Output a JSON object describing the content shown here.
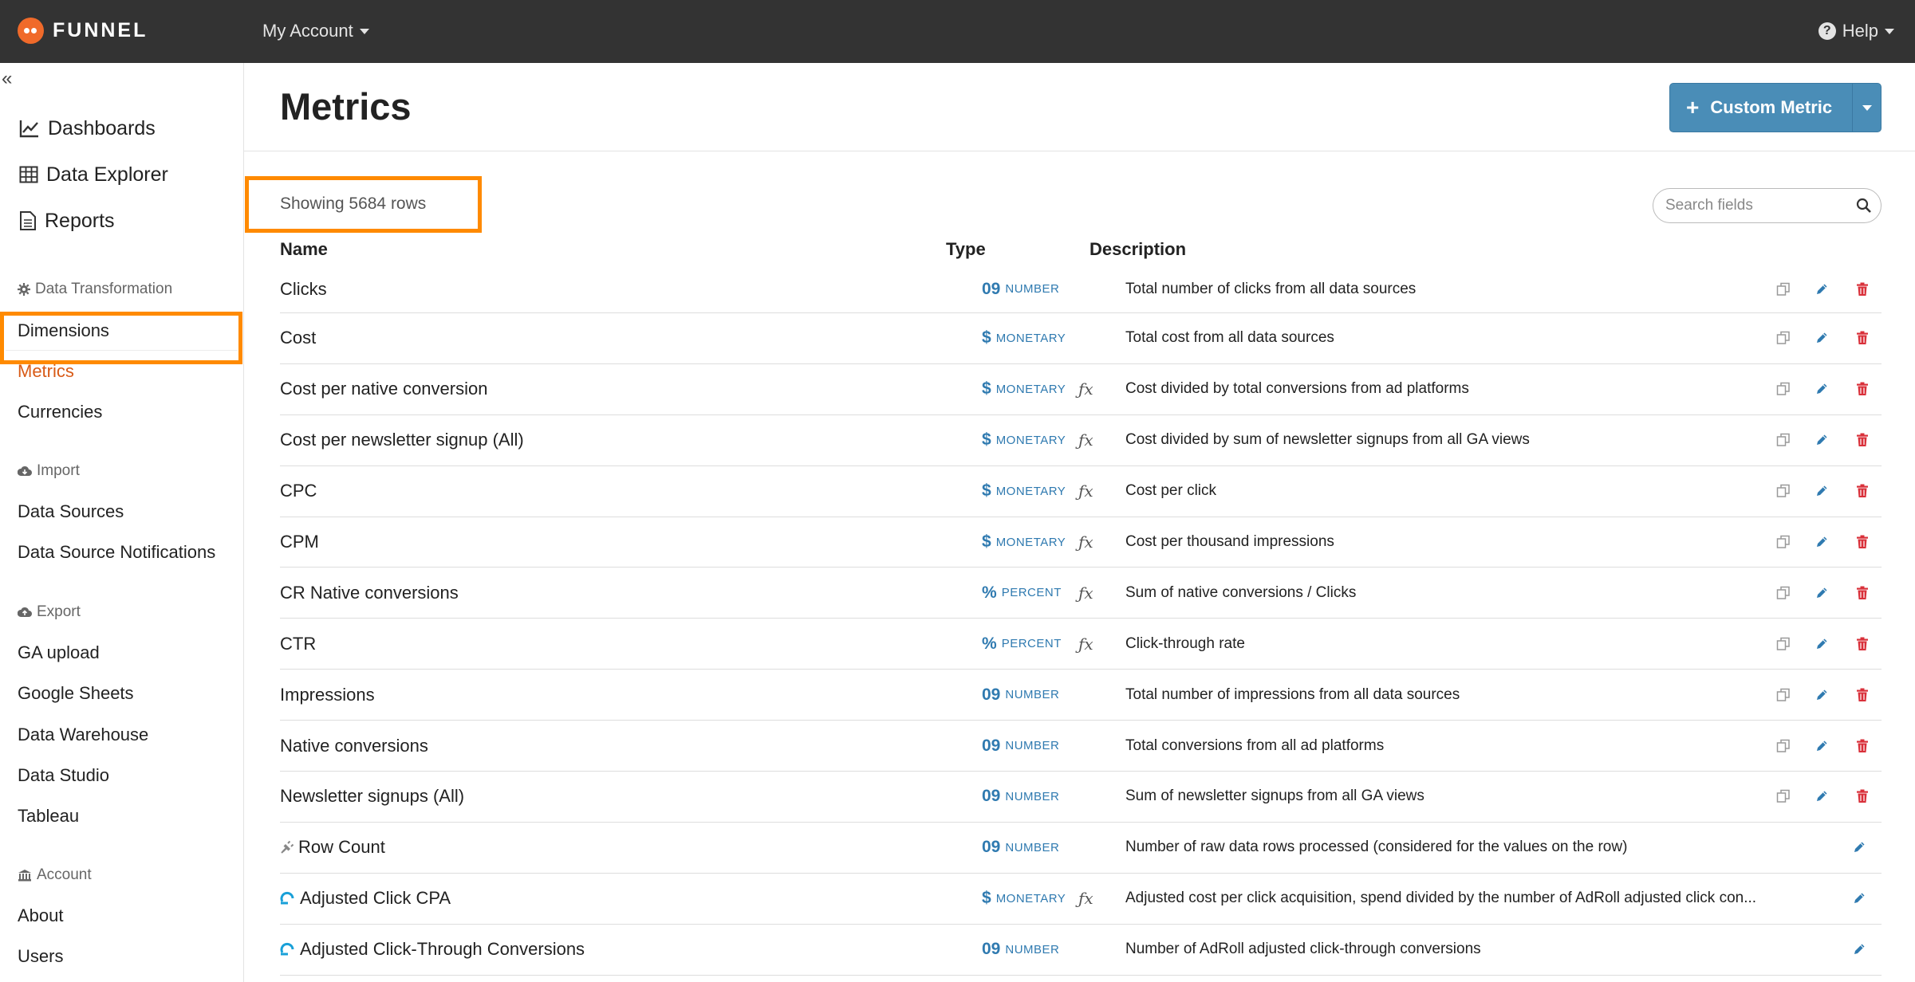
{
  "topbar": {
    "brand": "FUNNEL",
    "account_menu": "My Account",
    "help_menu": "Help"
  },
  "sidebar": {
    "main_items": [
      {
        "label": "Dashboards",
        "icon": "line-chart-icon"
      },
      {
        "label": "Data Explorer",
        "icon": "table-icon"
      },
      {
        "label": "Reports",
        "icon": "document-icon"
      }
    ],
    "data_transformation": {
      "heading": "Data Transformation",
      "items": [
        "Dimensions",
        "Metrics",
        "Currencies"
      ],
      "active": "Metrics"
    },
    "import": {
      "heading": "Import",
      "items": [
        "Data Sources",
        "Data Source Notifications"
      ]
    },
    "export": {
      "heading": "Export",
      "items": [
        "GA upload",
        "Google Sheets",
        "Data Warehouse",
        "Data Studio",
        "Tableau"
      ]
    },
    "account": {
      "heading": "Account",
      "items": [
        "About",
        "Users"
      ]
    }
  },
  "main": {
    "title": "Metrics",
    "custom_metric_button": "Custom Metric",
    "row_count_text": "Showing 5684 rows",
    "search_placeholder": "Search fields",
    "columns": {
      "name": "Name",
      "type": "Type",
      "description": "Description"
    },
    "rows": [
      {
        "name": "Clicks",
        "type_symbol": "09",
        "type": "NUMBER",
        "formula": "",
        "description": "Total number of clicks from all data sources",
        "actions": "full",
        "source_icon": ""
      },
      {
        "name": "Cost",
        "type_symbol": "$",
        "type": "MONETARY",
        "formula": "",
        "description": "Total cost from all data sources",
        "actions": "full",
        "source_icon": ""
      },
      {
        "name": "Cost per native conversion",
        "type_symbol": "$",
        "type": "MONETARY",
        "formula": "ƒx",
        "description": "Cost divided by total conversions from ad platforms",
        "actions": "full",
        "source_icon": ""
      },
      {
        "name": "Cost per newsletter signup (All)",
        "type_symbol": "$",
        "type": "MONETARY",
        "formula": "ƒx",
        "description": "Cost divided by sum of newsletter signups from all GA views",
        "actions": "full",
        "source_icon": ""
      },
      {
        "name": "CPC",
        "type_symbol": "$",
        "type": "MONETARY",
        "formula": "ƒx",
        "description": "Cost per click",
        "actions": "full",
        "source_icon": ""
      },
      {
        "name": "CPM",
        "type_symbol": "$",
        "type": "MONETARY",
        "formula": "ƒx",
        "description": "Cost per thousand impressions",
        "actions": "full",
        "source_icon": ""
      },
      {
        "name": "CR Native conversions",
        "type_symbol": "%",
        "type": "PERCENT",
        "formula": "ƒx",
        "description": "Sum of native conversions / Clicks",
        "actions": "full",
        "source_icon": ""
      },
      {
        "name": "CTR",
        "type_symbol": "%",
        "type": "PERCENT",
        "formula": "ƒx",
        "description": "Click-through rate",
        "actions": "full",
        "source_icon": ""
      },
      {
        "name": "Impressions",
        "type_symbol": "09",
        "type": "NUMBER",
        "formula": "",
        "description": "Total number of impressions from all data sources",
        "actions": "full",
        "source_icon": ""
      },
      {
        "name": "Native conversions",
        "type_symbol": "09",
        "type": "NUMBER",
        "formula": "",
        "description": "Total conversions from all ad platforms",
        "actions": "full",
        "source_icon": ""
      },
      {
        "name": "Newsletter signups (All)",
        "type_symbol": "09",
        "type": "NUMBER",
        "formula": "",
        "description": "Sum of newsletter signups from all GA views",
        "actions": "full",
        "source_icon": ""
      },
      {
        "name": "Row Count",
        "type_symbol": "09",
        "type": "NUMBER",
        "formula": "",
        "description": "Number of raw data rows processed (considered for the values on the row)",
        "actions": "edit",
        "source_icon": "plug-icon"
      },
      {
        "name": "Adjusted Click CPA",
        "type_symbol": "$",
        "type": "MONETARY",
        "formula": "ƒx",
        "description": "Adjusted cost per click acquisition, spend divided by the number of AdRoll adjusted click con...",
        "actions": "edit",
        "source_icon": "adroll-icon"
      },
      {
        "name": "Adjusted Click-Through Conversions",
        "type_symbol": "09",
        "type": "NUMBER",
        "formula": "",
        "description": "Number of AdRoll adjusted click-through conversions",
        "actions": "edit",
        "source_icon": "adroll-icon"
      }
    ]
  },
  "colors": {
    "topbar": "#333333",
    "accent_blue": "#2f7ab0",
    "button_blue": "#4a8db7",
    "highlight_orange": "#ff8a00",
    "active_nav": "#d85a16",
    "delete_red": "#d9303a"
  }
}
